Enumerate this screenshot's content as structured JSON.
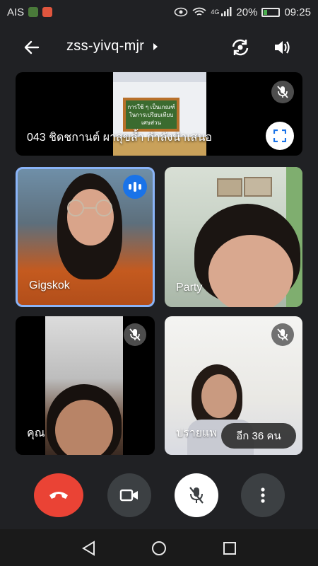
{
  "status": {
    "carrier": "AIS",
    "battery": "20%",
    "time": "09:25",
    "network": "4G"
  },
  "header": {
    "meeting_code": "zss-yivq-mjr"
  },
  "presentation": {
    "label": "043 ชิดชกานต์ ผาสุขล้ำ กำลังนำเสนอ",
    "slide_title_line1": "การใช้ ๆ เป็นเกณฑ์",
    "slide_title_line2": "ในการเปรียบเทียบเศษส่วน"
  },
  "participants": [
    {
      "name": "Gigskok",
      "speaking": true
    },
    {
      "name": "Party",
      "muted": false
    },
    {
      "name": "คุณ",
      "muted": true
    },
    {
      "name": "ปรายแพ",
      "muted": true
    }
  ],
  "more_chip": "อีก 36 คน",
  "colors": {
    "background": "#202124",
    "hangup": "#ea4335",
    "speaking_border": "#8ab4f8",
    "speaking_badge": "#1a73e8"
  }
}
